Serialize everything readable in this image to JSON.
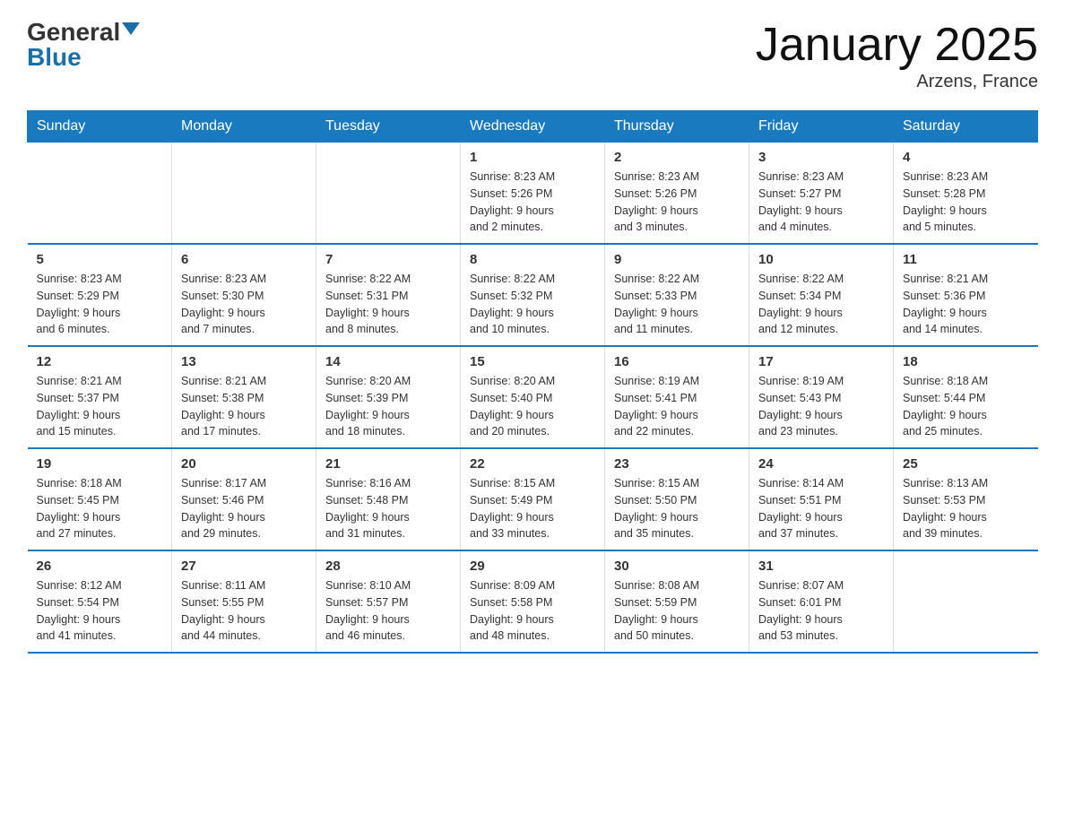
{
  "logo": {
    "general": "General",
    "arrow": "▶",
    "blue": "Blue"
  },
  "title": "January 2025",
  "location": "Arzens, France",
  "days_of_week": [
    "Sunday",
    "Monday",
    "Tuesday",
    "Wednesday",
    "Thursday",
    "Friday",
    "Saturday"
  ],
  "weeks": [
    [
      {
        "day": "",
        "info": ""
      },
      {
        "day": "",
        "info": ""
      },
      {
        "day": "",
        "info": ""
      },
      {
        "day": "1",
        "info": "Sunrise: 8:23 AM\nSunset: 5:26 PM\nDaylight: 9 hours\nand 2 minutes."
      },
      {
        "day": "2",
        "info": "Sunrise: 8:23 AM\nSunset: 5:26 PM\nDaylight: 9 hours\nand 3 minutes."
      },
      {
        "day": "3",
        "info": "Sunrise: 8:23 AM\nSunset: 5:27 PM\nDaylight: 9 hours\nand 4 minutes."
      },
      {
        "day": "4",
        "info": "Sunrise: 8:23 AM\nSunset: 5:28 PM\nDaylight: 9 hours\nand 5 minutes."
      }
    ],
    [
      {
        "day": "5",
        "info": "Sunrise: 8:23 AM\nSunset: 5:29 PM\nDaylight: 9 hours\nand 6 minutes."
      },
      {
        "day": "6",
        "info": "Sunrise: 8:23 AM\nSunset: 5:30 PM\nDaylight: 9 hours\nand 7 minutes."
      },
      {
        "day": "7",
        "info": "Sunrise: 8:22 AM\nSunset: 5:31 PM\nDaylight: 9 hours\nand 8 minutes."
      },
      {
        "day": "8",
        "info": "Sunrise: 8:22 AM\nSunset: 5:32 PM\nDaylight: 9 hours\nand 10 minutes."
      },
      {
        "day": "9",
        "info": "Sunrise: 8:22 AM\nSunset: 5:33 PM\nDaylight: 9 hours\nand 11 minutes."
      },
      {
        "day": "10",
        "info": "Sunrise: 8:22 AM\nSunset: 5:34 PM\nDaylight: 9 hours\nand 12 minutes."
      },
      {
        "day": "11",
        "info": "Sunrise: 8:21 AM\nSunset: 5:36 PM\nDaylight: 9 hours\nand 14 minutes."
      }
    ],
    [
      {
        "day": "12",
        "info": "Sunrise: 8:21 AM\nSunset: 5:37 PM\nDaylight: 9 hours\nand 15 minutes."
      },
      {
        "day": "13",
        "info": "Sunrise: 8:21 AM\nSunset: 5:38 PM\nDaylight: 9 hours\nand 17 minutes."
      },
      {
        "day": "14",
        "info": "Sunrise: 8:20 AM\nSunset: 5:39 PM\nDaylight: 9 hours\nand 18 minutes."
      },
      {
        "day": "15",
        "info": "Sunrise: 8:20 AM\nSunset: 5:40 PM\nDaylight: 9 hours\nand 20 minutes."
      },
      {
        "day": "16",
        "info": "Sunrise: 8:19 AM\nSunset: 5:41 PM\nDaylight: 9 hours\nand 22 minutes."
      },
      {
        "day": "17",
        "info": "Sunrise: 8:19 AM\nSunset: 5:43 PM\nDaylight: 9 hours\nand 23 minutes."
      },
      {
        "day": "18",
        "info": "Sunrise: 8:18 AM\nSunset: 5:44 PM\nDaylight: 9 hours\nand 25 minutes."
      }
    ],
    [
      {
        "day": "19",
        "info": "Sunrise: 8:18 AM\nSunset: 5:45 PM\nDaylight: 9 hours\nand 27 minutes."
      },
      {
        "day": "20",
        "info": "Sunrise: 8:17 AM\nSunset: 5:46 PM\nDaylight: 9 hours\nand 29 minutes."
      },
      {
        "day": "21",
        "info": "Sunrise: 8:16 AM\nSunset: 5:48 PM\nDaylight: 9 hours\nand 31 minutes."
      },
      {
        "day": "22",
        "info": "Sunrise: 8:15 AM\nSunset: 5:49 PM\nDaylight: 9 hours\nand 33 minutes."
      },
      {
        "day": "23",
        "info": "Sunrise: 8:15 AM\nSunset: 5:50 PM\nDaylight: 9 hours\nand 35 minutes."
      },
      {
        "day": "24",
        "info": "Sunrise: 8:14 AM\nSunset: 5:51 PM\nDaylight: 9 hours\nand 37 minutes."
      },
      {
        "day": "25",
        "info": "Sunrise: 8:13 AM\nSunset: 5:53 PM\nDaylight: 9 hours\nand 39 minutes."
      }
    ],
    [
      {
        "day": "26",
        "info": "Sunrise: 8:12 AM\nSunset: 5:54 PM\nDaylight: 9 hours\nand 41 minutes."
      },
      {
        "day": "27",
        "info": "Sunrise: 8:11 AM\nSunset: 5:55 PM\nDaylight: 9 hours\nand 44 minutes."
      },
      {
        "day": "28",
        "info": "Sunrise: 8:10 AM\nSunset: 5:57 PM\nDaylight: 9 hours\nand 46 minutes."
      },
      {
        "day": "29",
        "info": "Sunrise: 8:09 AM\nSunset: 5:58 PM\nDaylight: 9 hours\nand 48 minutes."
      },
      {
        "day": "30",
        "info": "Sunrise: 8:08 AM\nSunset: 5:59 PM\nDaylight: 9 hours\nand 50 minutes."
      },
      {
        "day": "31",
        "info": "Sunrise: 8:07 AM\nSunset: 6:01 PM\nDaylight: 9 hours\nand 53 minutes."
      },
      {
        "day": "",
        "info": ""
      }
    ]
  ]
}
